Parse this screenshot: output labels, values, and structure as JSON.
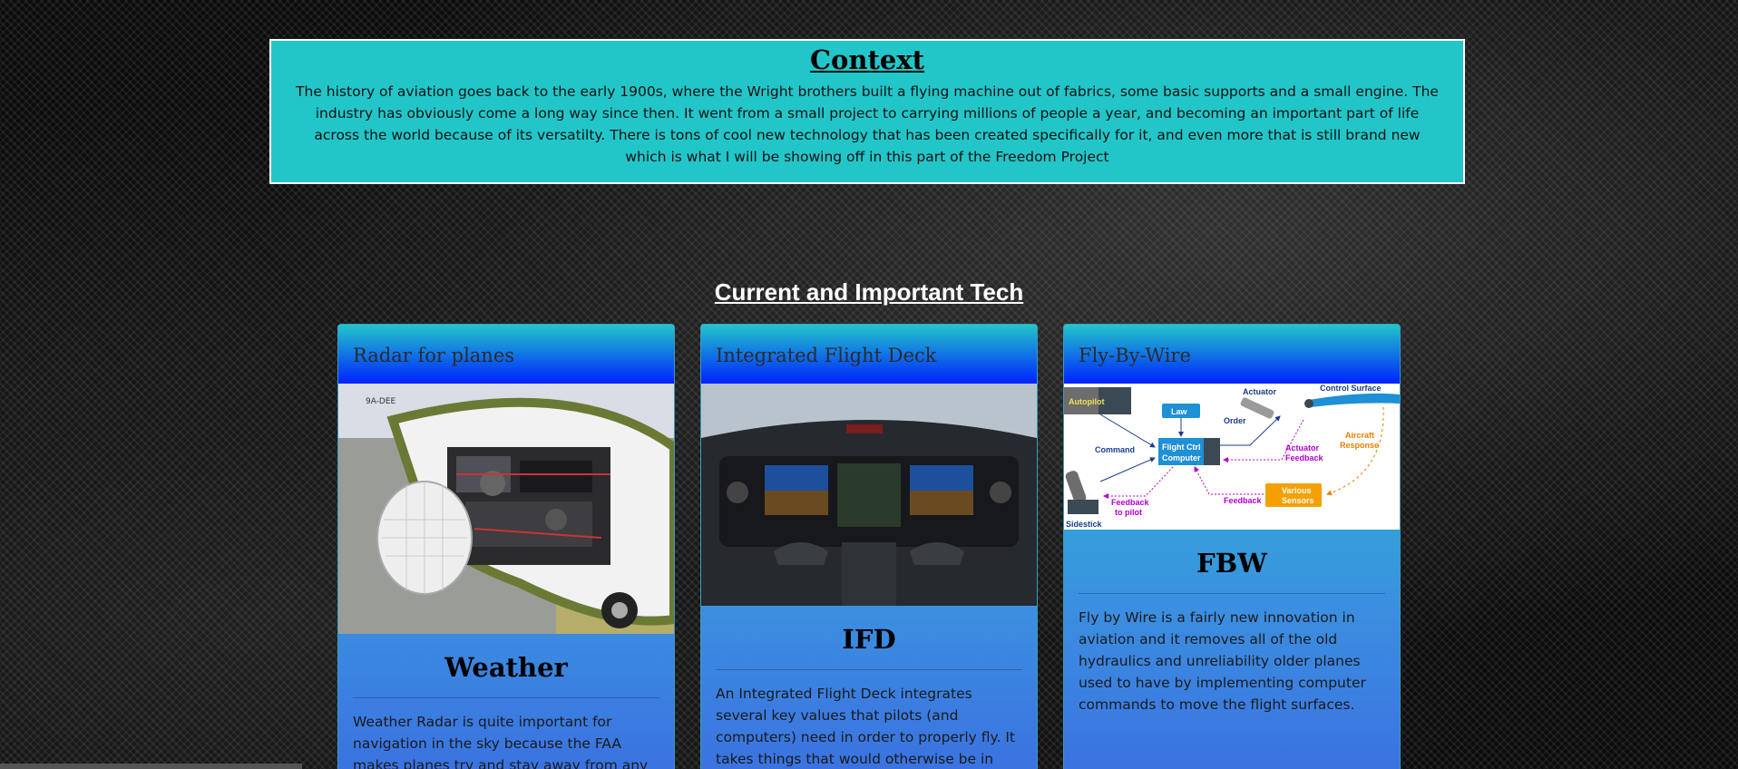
{
  "context": {
    "title": "Context",
    "text": "The history of aviation goes back to the early 1900s, where the Wright brothers built a flying machine out of fabrics, some basic supports and a small engine. The industry has obviously come a long way since then. It went from a small project to carrying millions of people a year, and becoming an important part of life across the world because of its versatilty. There is tons of cool new technology that has been created specifically for it, and even more that is still brand new which is what I will be showing off in this part of the Freedom Project"
  },
  "section": {
    "title": "Current and Important Tech"
  },
  "cards": [
    {
      "header": "Radar for planes",
      "heading": "Weather",
      "text": "Weather Radar is quite important for navigation in the sky because the FAA makes planes try and stay away from any cloud"
    },
    {
      "header": "Integrated Flight Deck",
      "heading": "IFD",
      "text": "An Integrated Flight Deck integrates several key values that pilots (and computers) need in order to properly fly. It takes things that would otherwise be in lots and lots of dials and"
    },
    {
      "header": "Fly-By-Wire",
      "heading": "FBW",
      "text": "Fly by Wire is a fairly new innovation in aviation and it removes all of the old hydraulics and unreliability older planes used to have by implementing computer commands to move the flight surfaces."
    }
  ],
  "fbw_diagram": {
    "autopilot": "Autopilot",
    "law": "Law",
    "actuator": "Actuator",
    "control_surface": "Control Surface",
    "order": "Order",
    "command": "Command",
    "flight_ctrl": "Flight Ctrl",
    "computer": "Computer",
    "actuator_feedback_1": "Actuator",
    "actuator_feedback_2": "Feedback",
    "aircraft_response_1": "Aircraft",
    "aircraft_response_2": "Response",
    "various_sensors_1": "Various",
    "various_sensors_2": "Sensors",
    "feedback": "Feedback",
    "feedback_pilot_1": "Feedback",
    "feedback_pilot_2": "to pilot",
    "sidestick": "Sidestick"
  },
  "radar_photo": {
    "tail_code": "9A-DEE"
  },
  "colors": {
    "context_bg": "#22c6c9",
    "card_header_top": "#22c6c9",
    "card_header_bottom": "#0022ff",
    "card_body_bottom": "#3b6ee0"
  }
}
